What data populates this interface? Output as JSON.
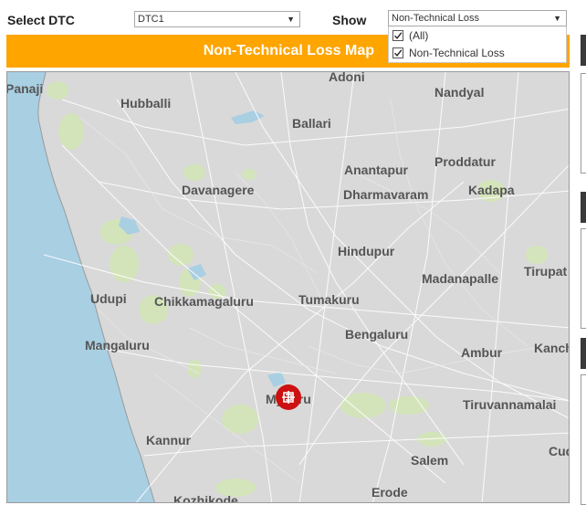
{
  "controls": {
    "select_dtc_label": "Select DTC",
    "select_dtc_value": "DTC1",
    "show_label": "Show",
    "show_value": "Non-Technical Loss",
    "show_options": [
      {
        "label": "(All)",
        "checked": true
      },
      {
        "label": "Non-Technical Loss",
        "checked": true
      }
    ]
  },
  "map": {
    "title": "Non-Technical Loss Map",
    "cities": [
      "Panaji",
      "Hubballi",
      "Adoni",
      "Nandyal",
      "Ballari",
      "Anantapur",
      "Proddatur",
      "Davanagere",
      "Dharmavaram",
      "Kadapa",
      "Hindupur",
      "Tirupat",
      "Madanapalle",
      "Udupi",
      "Chikkamagaluru",
      "Tumakuru",
      "Bengaluru",
      "Kanch",
      "Mangaluru",
      "Ambur",
      "Mysuru",
      "Tiruvannamalai",
      "Kannur",
      "Cud",
      "Salem",
      "Erode",
      "Kozhikode"
    ],
    "marker": {
      "icon": "dtc-location-marker-icon",
      "color": "#CC1111"
    }
  },
  "colors": {
    "banner": "#FFA500",
    "water": "#A9CFE3",
    "land": "#D9D9D9",
    "parks": "#D3E6B5",
    "marker": "#CC1111"
  }
}
